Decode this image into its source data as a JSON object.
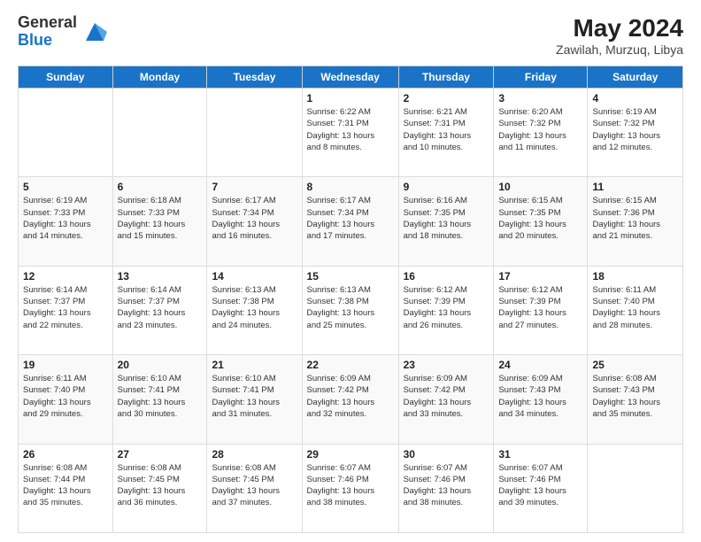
{
  "header": {
    "logo_general": "General",
    "logo_blue": "Blue",
    "title": "May 2024",
    "location": "Zawilah, Murzuq, Libya"
  },
  "weekdays": [
    "Sunday",
    "Monday",
    "Tuesday",
    "Wednesday",
    "Thursday",
    "Friday",
    "Saturday"
  ],
  "weeks": [
    [
      {
        "day": "",
        "info": ""
      },
      {
        "day": "",
        "info": ""
      },
      {
        "day": "",
        "info": ""
      },
      {
        "day": "1",
        "info": "Sunrise: 6:22 AM\nSunset: 7:31 PM\nDaylight: 13 hours\nand 8 minutes."
      },
      {
        "day": "2",
        "info": "Sunrise: 6:21 AM\nSunset: 7:31 PM\nDaylight: 13 hours\nand 10 minutes."
      },
      {
        "day": "3",
        "info": "Sunrise: 6:20 AM\nSunset: 7:32 PM\nDaylight: 13 hours\nand 11 minutes."
      },
      {
        "day": "4",
        "info": "Sunrise: 6:19 AM\nSunset: 7:32 PM\nDaylight: 13 hours\nand 12 minutes."
      }
    ],
    [
      {
        "day": "5",
        "info": "Sunrise: 6:19 AM\nSunset: 7:33 PM\nDaylight: 13 hours\nand 14 minutes."
      },
      {
        "day": "6",
        "info": "Sunrise: 6:18 AM\nSunset: 7:33 PM\nDaylight: 13 hours\nand 15 minutes."
      },
      {
        "day": "7",
        "info": "Sunrise: 6:17 AM\nSunset: 7:34 PM\nDaylight: 13 hours\nand 16 minutes."
      },
      {
        "day": "8",
        "info": "Sunrise: 6:17 AM\nSunset: 7:34 PM\nDaylight: 13 hours\nand 17 minutes."
      },
      {
        "day": "9",
        "info": "Sunrise: 6:16 AM\nSunset: 7:35 PM\nDaylight: 13 hours\nand 18 minutes."
      },
      {
        "day": "10",
        "info": "Sunrise: 6:15 AM\nSunset: 7:35 PM\nDaylight: 13 hours\nand 20 minutes."
      },
      {
        "day": "11",
        "info": "Sunrise: 6:15 AM\nSunset: 7:36 PM\nDaylight: 13 hours\nand 21 minutes."
      }
    ],
    [
      {
        "day": "12",
        "info": "Sunrise: 6:14 AM\nSunset: 7:37 PM\nDaylight: 13 hours\nand 22 minutes."
      },
      {
        "day": "13",
        "info": "Sunrise: 6:14 AM\nSunset: 7:37 PM\nDaylight: 13 hours\nand 23 minutes."
      },
      {
        "day": "14",
        "info": "Sunrise: 6:13 AM\nSunset: 7:38 PM\nDaylight: 13 hours\nand 24 minutes."
      },
      {
        "day": "15",
        "info": "Sunrise: 6:13 AM\nSunset: 7:38 PM\nDaylight: 13 hours\nand 25 minutes."
      },
      {
        "day": "16",
        "info": "Sunrise: 6:12 AM\nSunset: 7:39 PM\nDaylight: 13 hours\nand 26 minutes."
      },
      {
        "day": "17",
        "info": "Sunrise: 6:12 AM\nSunset: 7:39 PM\nDaylight: 13 hours\nand 27 minutes."
      },
      {
        "day": "18",
        "info": "Sunrise: 6:11 AM\nSunset: 7:40 PM\nDaylight: 13 hours\nand 28 minutes."
      }
    ],
    [
      {
        "day": "19",
        "info": "Sunrise: 6:11 AM\nSunset: 7:40 PM\nDaylight: 13 hours\nand 29 minutes."
      },
      {
        "day": "20",
        "info": "Sunrise: 6:10 AM\nSunset: 7:41 PM\nDaylight: 13 hours\nand 30 minutes."
      },
      {
        "day": "21",
        "info": "Sunrise: 6:10 AM\nSunset: 7:41 PM\nDaylight: 13 hours\nand 31 minutes."
      },
      {
        "day": "22",
        "info": "Sunrise: 6:09 AM\nSunset: 7:42 PM\nDaylight: 13 hours\nand 32 minutes."
      },
      {
        "day": "23",
        "info": "Sunrise: 6:09 AM\nSunset: 7:42 PM\nDaylight: 13 hours\nand 33 minutes."
      },
      {
        "day": "24",
        "info": "Sunrise: 6:09 AM\nSunset: 7:43 PM\nDaylight: 13 hours\nand 34 minutes."
      },
      {
        "day": "25",
        "info": "Sunrise: 6:08 AM\nSunset: 7:43 PM\nDaylight: 13 hours\nand 35 minutes."
      }
    ],
    [
      {
        "day": "26",
        "info": "Sunrise: 6:08 AM\nSunset: 7:44 PM\nDaylight: 13 hours\nand 35 minutes."
      },
      {
        "day": "27",
        "info": "Sunrise: 6:08 AM\nSunset: 7:45 PM\nDaylight: 13 hours\nand 36 minutes."
      },
      {
        "day": "28",
        "info": "Sunrise: 6:08 AM\nSunset: 7:45 PM\nDaylight: 13 hours\nand 37 minutes."
      },
      {
        "day": "29",
        "info": "Sunrise: 6:07 AM\nSunset: 7:46 PM\nDaylight: 13 hours\nand 38 minutes."
      },
      {
        "day": "30",
        "info": "Sunrise: 6:07 AM\nSunset: 7:46 PM\nDaylight: 13 hours\nand 38 minutes."
      },
      {
        "day": "31",
        "info": "Sunrise: 6:07 AM\nSunset: 7:46 PM\nDaylight: 13 hours\nand 39 minutes."
      },
      {
        "day": "",
        "info": ""
      }
    ]
  ]
}
